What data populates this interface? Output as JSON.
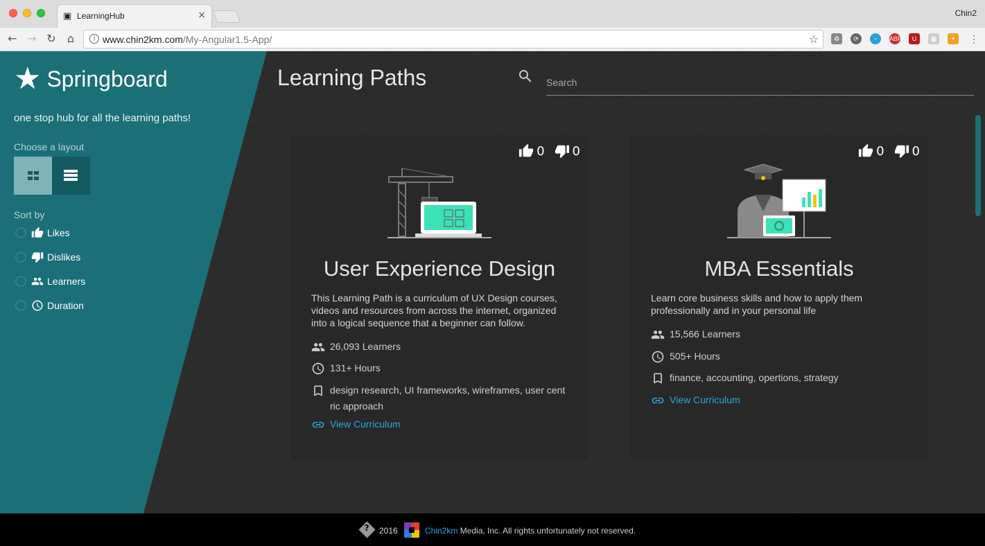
{
  "browser": {
    "tab_title": "LearningHub",
    "profile_name": "Chin2",
    "url_host": "www.chin2km.com",
    "url_path": "/My-Angular1.5-App/"
  },
  "sidebar": {
    "brand": "Springboard",
    "tagline": "one stop hub for all the learning paths!",
    "layout_label": "Choose a layout",
    "sort_label": "Sort by",
    "sort_options": [
      {
        "label": "Likes",
        "icon": "thumb-up-icon"
      },
      {
        "label": "Dislikes",
        "icon": "thumb-down-icon"
      },
      {
        "label": "Learners",
        "icon": "people-icon"
      },
      {
        "label": "Duration",
        "icon": "clock-icon"
      }
    ],
    "accent_color": "#1b6f77"
  },
  "main": {
    "title": "Learning Paths",
    "search_placeholder": "Search",
    "cards": [
      {
        "title": "User Experience Design",
        "likes": "0",
        "dislikes": "0",
        "description": "This Learning Path is a curriculum of UX Design courses, videos and resources from across the internet, organized into a logical sequence that a beginner can follow.",
        "learners": "26,093 Learners",
        "hours": "131+ Hours",
        "tags": "design research, UI frameworks, wireframes, user cent ric approach",
        "link": "View Curriculum"
      },
      {
        "title": "MBA Essentials",
        "likes": "0",
        "dislikes": "0",
        "description": "Learn core business skills and how to apply them professionally and in your personal life",
        "learners": "15,566 Learners",
        "hours": "505+ Hours",
        "tags": "finance, accounting, opertions, strategy",
        "link": "View Curriculum"
      }
    ]
  },
  "footer": {
    "year": "2016",
    "brand": "Chin2km",
    "text": " Media, Inc. All rights unfortunately not reserved."
  }
}
